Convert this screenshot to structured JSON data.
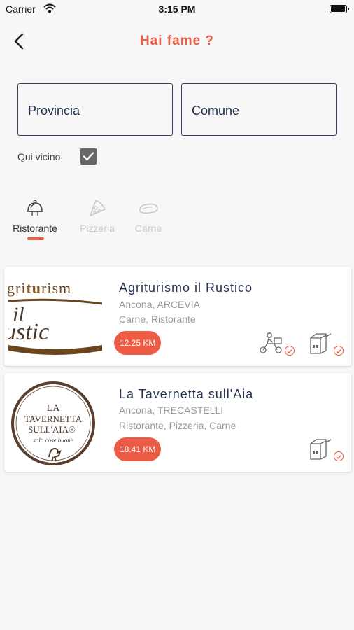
{
  "status_bar": {
    "carrier": "Carrier",
    "time": "3:15 PM",
    "battery_level": 1.0
  },
  "nav": {
    "title": "Hai fame ?",
    "back_icon": "chevron-left-icon"
  },
  "filters": {
    "provincia": "Provincia",
    "comune": "Comune",
    "near_label": "Qui vicino",
    "near_checked": true
  },
  "categories": [
    {
      "label": "Ristorante",
      "icon": "cloche-icon",
      "selected": true
    },
    {
      "label": "Pizzeria",
      "icon": "pizza-slice-icon",
      "selected": false
    },
    {
      "label": "Carne",
      "icon": "meat-icon",
      "selected": false
    }
  ],
  "restaurants": [
    {
      "name": "Agriturismo il Rustico",
      "location": "Ancona, ARCEVIA",
      "categories": "Carne, Ristorante",
      "distance": "12.25 KM",
      "logo_text": [
        "gri",
        "tu",
        "rism",
        "il",
        "ustic"
      ],
      "services": [
        "delivery-scooter-icon",
        "takeaway-bag-icon"
      ]
    },
    {
      "name": "La Tavernetta sull'Aia",
      "location": "Ancona, TRECASTELLI",
      "categories": "Ristorante, Pizzeria, Carne",
      "distance": "18.41 KM",
      "logo_text": [
        "LA",
        "TAVERNETTA",
        "SULL'AIA®",
        "solo cose buone"
      ],
      "services": [
        "takeaway-bag-icon"
      ]
    }
  ],
  "colors": {
    "accent": "#ec5b43",
    "field_border": "#3a4064",
    "name_text": "#2a3457",
    "logo_brown": "#6b4420",
    "logo_dark": "#4a3528"
  }
}
